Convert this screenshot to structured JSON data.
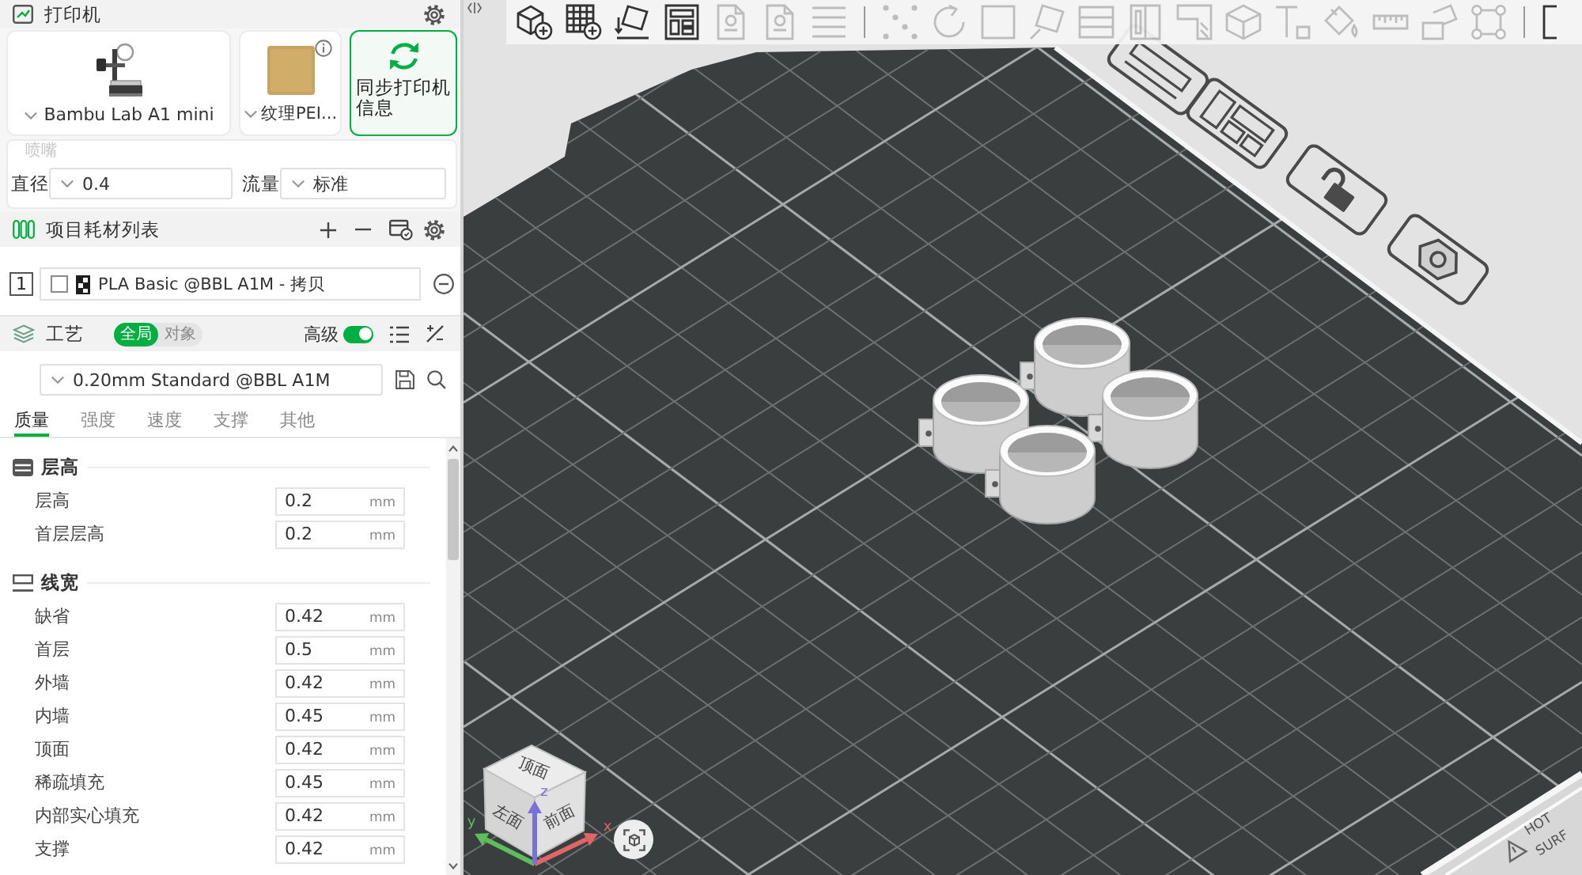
{
  "printer_section": {
    "title": "打印机",
    "printer_name": "Bambu Lab A1 mini",
    "plate_name": "纹理PEI...",
    "sync_button": "同步打印机信息",
    "nozzle_title": "喷嘴",
    "diameter_label": "直径",
    "diameter": "0.4",
    "flow_label": "流量",
    "flow": "标准"
  },
  "filament_section": {
    "title": "项目耗材列表",
    "items": [
      {
        "number": "1",
        "checked": false,
        "name": "PLA Basic @BBL A1M - 拷贝"
      }
    ]
  },
  "process_section": {
    "title": "工艺",
    "scopes": [
      {
        "label": "全局",
        "selected": true
      },
      {
        "label": "对象",
        "selected": false
      }
    ],
    "advanced_label": "高级",
    "advanced_on": true,
    "preset": "0.20mm Standard @BBL A1M",
    "tabs": [
      {
        "label": "质量",
        "selected": true
      },
      {
        "label": "强度",
        "selected": false
      },
      {
        "label": "速度",
        "selected": false
      },
      {
        "label": "支撑",
        "selected": false
      },
      {
        "label": "其他",
        "selected": false
      }
    ],
    "groups": [
      {
        "kind": "layer",
        "title": "层高",
        "settings": [
          {
            "label": "层高",
            "value": "0.2",
            "unit": "mm"
          },
          {
            "label": "首层层高",
            "value": "0.2",
            "unit": "mm"
          }
        ]
      },
      {
        "kind": "line-width",
        "title": "线宽",
        "settings": [
          {
            "label": "缺省",
            "value": "0.42",
            "unit": "mm"
          },
          {
            "label": "首层",
            "value": "0.5",
            "unit": "mm"
          },
          {
            "label": "外墙",
            "value": "0.42",
            "unit": "mm"
          },
          {
            "label": "内墙",
            "value": "0.45",
            "unit": "mm"
          },
          {
            "label": "顶面",
            "value": "0.42",
            "unit": "mm"
          },
          {
            "label": "稀疏填充",
            "value": "0.45",
            "unit": "mm"
          },
          {
            "label": "内部实心填充",
            "value": "0.42",
            "unit": "mm"
          },
          {
            "label": "支撑",
            "value": "0.42",
            "unit": "mm"
          }
        ]
      }
    ]
  },
  "toolbar": {
    "tools": [
      {
        "kind": "add-cube",
        "disabled": false
      },
      {
        "kind": "add-plate",
        "disabled": false
      },
      {
        "kind": "auto-orient",
        "disabled": false
      },
      {
        "kind": "arrange",
        "disabled": false
      },
      {
        "kind": "page",
        "disabled": true
      },
      {
        "kind": "page",
        "disabled": true
      },
      {
        "kind": "lines",
        "disabled": true
      },
      {
        "kind": "separator"
      },
      {
        "kind": "dots",
        "disabled": true
      },
      {
        "kind": "rotate",
        "disabled": true
      },
      {
        "kind": "square",
        "disabled": true
      },
      {
        "kind": "tilted-square",
        "disabled": true
      },
      {
        "kind": "panel",
        "disabled": true
      },
      {
        "kind": "split-square",
        "disabled": true
      },
      {
        "kind": "l-shape",
        "disabled": true
      },
      {
        "kind": "cube",
        "disabled": true
      },
      {
        "kind": "text",
        "disabled": true
      },
      {
        "kind": "bucket",
        "disabled": true
      },
      {
        "kind": "ruler",
        "disabled": true
      },
      {
        "kind": "boxes",
        "disabled": true
      },
      {
        "kind": "frame",
        "disabled": true
      },
      {
        "kind": "separator"
      },
      {
        "kind": "square",
        "disabled": false,
        "cut_off": true
      }
    ]
  },
  "viewport": {
    "plate_warning": [
      "HOT",
      "SURF"
    ],
    "view_cube": {
      "top": "顶面",
      "left": "左面",
      "front": "前面"
    },
    "axes": [
      {
        "label": "x",
        "color": "#e06666"
      },
      {
        "label": "y",
        "color": "#5cbf5c"
      },
      {
        "label": "z",
        "color": "#7b6fd8"
      }
    ]
  }
}
